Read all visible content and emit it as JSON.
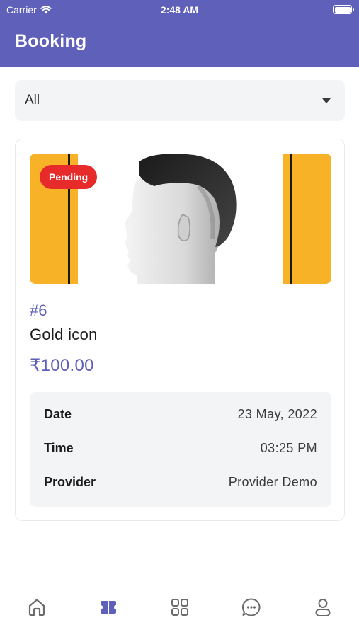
{
  "status_bar": {
    "carrier": "Carrier",
    "time": "2:48 AM"
  },
  "header": {
    "title": "Booking"
  },
  "filter": {
    "selected": "All"
  },
  "booking": {
    "status": "Pending",
    "id": "#6",
    "service": "Gold icon",
    "price": "₹100.00",
    "details": [
      {
        "label": "Date",
        "value": "23 May, 2022"
      },
      {
        "label": "Time",
        "value": "03:25 PM"
      },
      {
        "label": "Provider",
        "value": "Provider Demo"
      }
    ]
  },
  "tabbar": {
    "items": [
      {
        "icon": "home-icon",
        "active": false
      },
      {
        "icon": "booking-icon",
        "active": true
      },
      {
        "icon": "categories-icon",
        "active": false
      },
      {
        "icon": "chat-icon",
        "active": false
      },
      {
        "icon": "profile-icon",
        "active": false
      }
    ]
  },
  "colors": {
    "primary": "#5f60b9",
    "badge_pending": "#e72b2b",
    "hero_stripe": "#f8b227",
    "surface": "#f3f4f6",
    "inactive_icon": "#6b6b6b"
  }
}
